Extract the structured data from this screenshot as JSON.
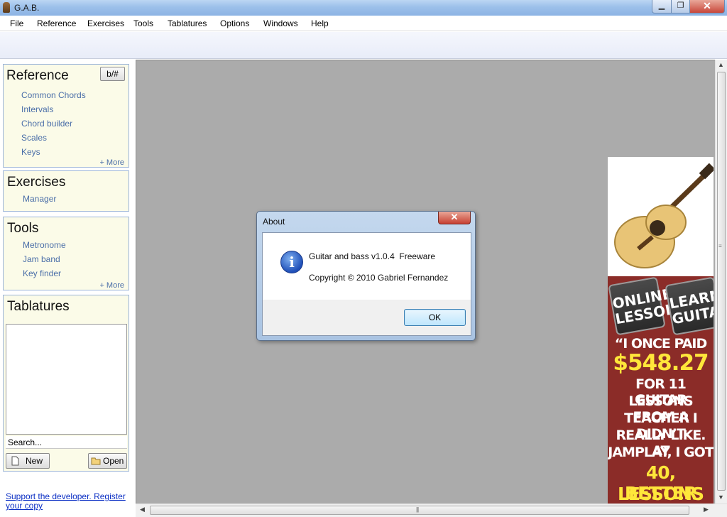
{
  "window": {
    "title": "G.A.B.",
    "min_glyph": "▁",
    "max_glyph": "❐",
    "close_glyph": "✕"
  },
  "menu": [
    "File",
    "Reference",
    "Exercises",
    "Tools",
    "Tablatures",
    "Options",
    "Windows",
    "Help"
  ],
  "reference": {
    "title": "Reference",
    "toggle_label": "b/#",
    "links": [
      "Common Chords",
      "Intervals",
      "Chord builder",
      "Scales",
      "Keys"
    ],
    "more": "+ More"
  },
  "exercises": {
    "title": "Exercises",
    "links": [
      "Manager"
    ]
  },
  "tools": {
    "title": "Tools",
    "links": [
      "Metronome",
      "Jam band",
      "Key finder"
    ],
    "more": "+ More"
  },
  "tablatures": {
    "title": "Tablatures",
    "search_value": "Search...",
    "new_label": "New",
    "open_label": "Open"
  },
  "support_link": "Support the developer. Register your copy",
  "ad": {
    "badge_left": "ONLINE LESSONS",
    "badge_right": "LEARN GUITAR",
    "line1": "“I ONCE PAID",
    "price": "$548.27",
    "line2": "FOR 11 GUITAR",
    "line3": "LESSONS FROM A",
    "line4": "TEACHER I DIDN’T",
    "line5": "REALLY LIKE.  AT",
    "line6": "JAMPLAY, I GOT",
    "line7": "40, BETTER",
    "line8": "LESSONS"
  },
  "about": {
    "title": "About",
    "close_glyph": "✕",
    "line1": "Guitar and bass v1.0.4  Freeware",
    "line2": "Copyright © 2010 Gabriel Fernandez",
    "ok_label": "OK",
    "info_glyph": "i"
  },
  "colors": {
    "link": "#4a6ea8",
    "panel_bg": "#fbfbe8",
    "mdi_bg": "#ababab",
    "ad_red": "#8b2c28",
    "ad_yellow": "#ffe63a"
  }
}
